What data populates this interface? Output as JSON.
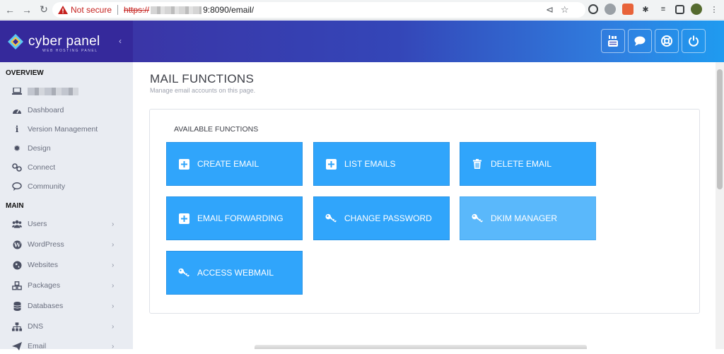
{
  "browser": {
    "not_secure": "Not secure",
    "url_scheme": "https://",
    "url_rest": "9:8090/email/"
  },
  "brand": {
    "logo_text": "cyber panel",
    "logo_sub": "WEB HOSTING PANEL"
  },
  "header_buttons": [
    {
      "icon": "youtube-icon"
    },
    {
      "icon": "chat-icon"
    },
    {
      "icon": "lifebuoy-icon"
    },
    {
      "icon": "power-icon"
    }
  ],
  "sidebar": {
    "overview_label": "OVERVIEW",
    "main_label": "MAIN",
    "overview_items": [
      {
        "label": "Dashboard",
        "icon": "tachometer-icon"
      },
      {
        "label": "Version Management",
        "icon": "info-icon"
      },
      {
        "label": "Design",
        "icon": "cog-icon"
      },
      {
        "label": "Connect",
        "icon": "link-icon"
      },
      {
        "label": "Community",
        "icon": "comments-icon"
      }
    ],
    "main_items": [
      {
        "label": "Users",
        "icon": "users-icon"
      },
      {
        "label": "WordPress",
        "icon": "wordpress-icon"
      },
      {
        "label": "Websites",
        "icon": "globe-icon"
      },
      {
        "label": "Packages",
        "icon": "cubes-icon"
      },
      {
        "label": "Databases",
        "icon": "database-icon"
      },
      {
        "label": "DNS",
        "icon": "sitemap-icon"
      },
      {
        "label": "Email",
        "icon": "paper-plane-icon"
      }
    ]
  },
  "page": {
    "title": "MAIL FUNCTIONS",
    "subtitle": "Manage email accounts on this page.",
    "panel_heading": "AVAILABLE FUNCTIONS"
  },
  "functions": [
    {
      "label": "CREATE EMAIL",
      "icon": "plus-square-icon"
    },
    {
      "label": "LIST EMAILS",
      "icon": "plus-square-icon"
    },
    {
      "label": "DELETE EMAIL",
      "icon": "trash-icon"
    },
    {
      "label": "EMAIL FORWARDING",
      "icon": "plus-square-icon"
    },
    {
      "label": "CHANGE PASSWORD",
      "icon": "key-icon"
    },
    {
      "label": "DKIM MANAGER",
      "icon": "key-icon"
    },
    {
      "label": "ACCESS WEBMAIL",
      "icon": "key-icon"
    }
  ],
  "colors": {
    "header_start": "#3d2d9e",
    "header_end": "#1f9bf0",
    "sidebar_bg": "#e9ecf2",
    "button_blue": "#30a5fb",
    "button_blue_hover": "#5ab8fb"
  }
}
